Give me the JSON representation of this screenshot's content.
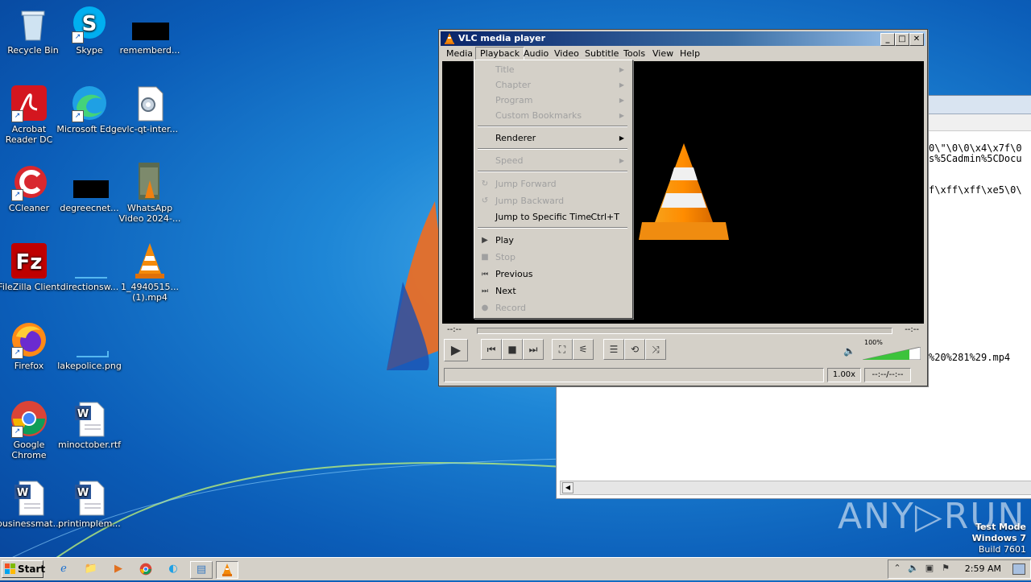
{
  "desktop": {
    "icons": [
      {
        "label": "Recycle Bin",
        "icon": "recycle-bin-icon"
      },
      {
        "label": "Skype",
        "icon": "skype-icon"
      },
      {
        "label": "rememberd...",
        "icon": "redacted-file-icon"
      },
      {
        "label": "Acrobat Reader DC",
        "icon": "acrobat-icon"
      },
      {
        "label": "Microsoft Edge",
        "icon": "edge-icon"
      },
      {
        "label": "vlc-qt-inter...",
        "icon": "settings-file-icon"
      },
      {
        "label": "CCleaner",
        "icon": "ccleaner-icon"
      },
      {
        "label": "degreecnet...",
        "icon": "redacted-file-icon"
      },
      {
        "label": "WhatsApp Video 2024-...",
        "icon": "video-file-icon"
      },
      {
        "label": "FileZilla Client",
        "icon": "filezilla-icon"
      },
      {
        "label": "directionsw...",
        "icon": "blank-file-icon"
      },
      {
        "label": "1_4940515... (1).mp4",
        "icon": "vlc-file-icon"
      },
      {
        "label": "Firefox",
        "icon": "firefox-icon"
      },
      {
        "label": "lakepolice.png",
        "icon": "image-file-icon"
      },
      {
        "label": "Google Chrome",
        "icon": "chrome-icon"
      },
      {
        "label": "minoctober.rtf",
        "icon": "word-doc-icon"
      },
      {
        "label": "businessmat...",
        "icon": "word-doc-icon"
      },
      {
        "label": "printimplem...",
        "icon": "word-doc-icon"
      }
    ]
  },
  "background_window": {
    "lines": [
      "0\\\"\\0\\0\\x4\\x7f\\0",
      "s%5Cadmin%5CDocu",
      "f\\xff\\xff\\xe5\\0\\",
      "%20%281%29.mp4"
    ]
  },
  "vlc": {
    "title": "VLC media player",
    "window_buttons": {
      "minimize": "_",
      "maximize": "□",
      "close": "✕"
    },
    "menu": [
      "Media",
      "Playback",
      "Audio",
      "Video",
      "Subtitle",
      "Tools",
      "View",
      "Help"
    ],
    "time_elapsed": "--:--",
    "time_total": "--:--",
    "volume_percent": "100%",
    "volume_level": 1.0,
    "speed": "1.00x",
    "status_time": "--:--/--:--"
  },
  "playback_menu": {
    "items": [
      {
        "label": "Title",
        "disabled": true,
        "submenu": true
      },
      {
        "label": "Chapter",
        "disabled": true,
        "submenu": true
      },
      {
        "label": "Program",
        "disabled": true,
        "submenu": true
      },
      {
        "label": "Custom Bookmarks",
        "disabled": true,
        "submenu": true
      },
      {
        "label": "Renderer",
        "disabled": false,
        "submenu": true
      },
      {
        "label": "Speed",
        "disabled": true,
        "submenu": true
      },
      {
        "label": "Jump Forward",
        "disabled": true
      },
      {
        "label": "Jump Backward",
        "disabled": true
      },
      {
        "label": "Jump to Specific Time",
        "disabled": false,
        "shortcut": "Ctrl+T"
      },
      {
        "label": "Play",
        "disabled": false,
        "icon": "play-icon"
      },
      {
        "label": "Stop",
        "disabled": true,
        "icon": "stop-icon"
      },
      {
        "label": "Previous",
        "disabled": false,
        "icon": "previous-icon"
      },
      {
        "label": "Next",
        "disabled": false,
        "icon": "next-icon"
      },
      {
        "label": "Record",
        "disabled": true,
        "icon": "record-icon"
      }
    ]
  },
  "watermark": {
    "brand": "ANY▷RUN",
    "test_mode": "Test Mode",
    "os": "Windows 7",
    "build": "Build 7601"
  },
  "taskbar": {
    "start_label": "Start",
    "clock": "2:59 AM"
  }
}
